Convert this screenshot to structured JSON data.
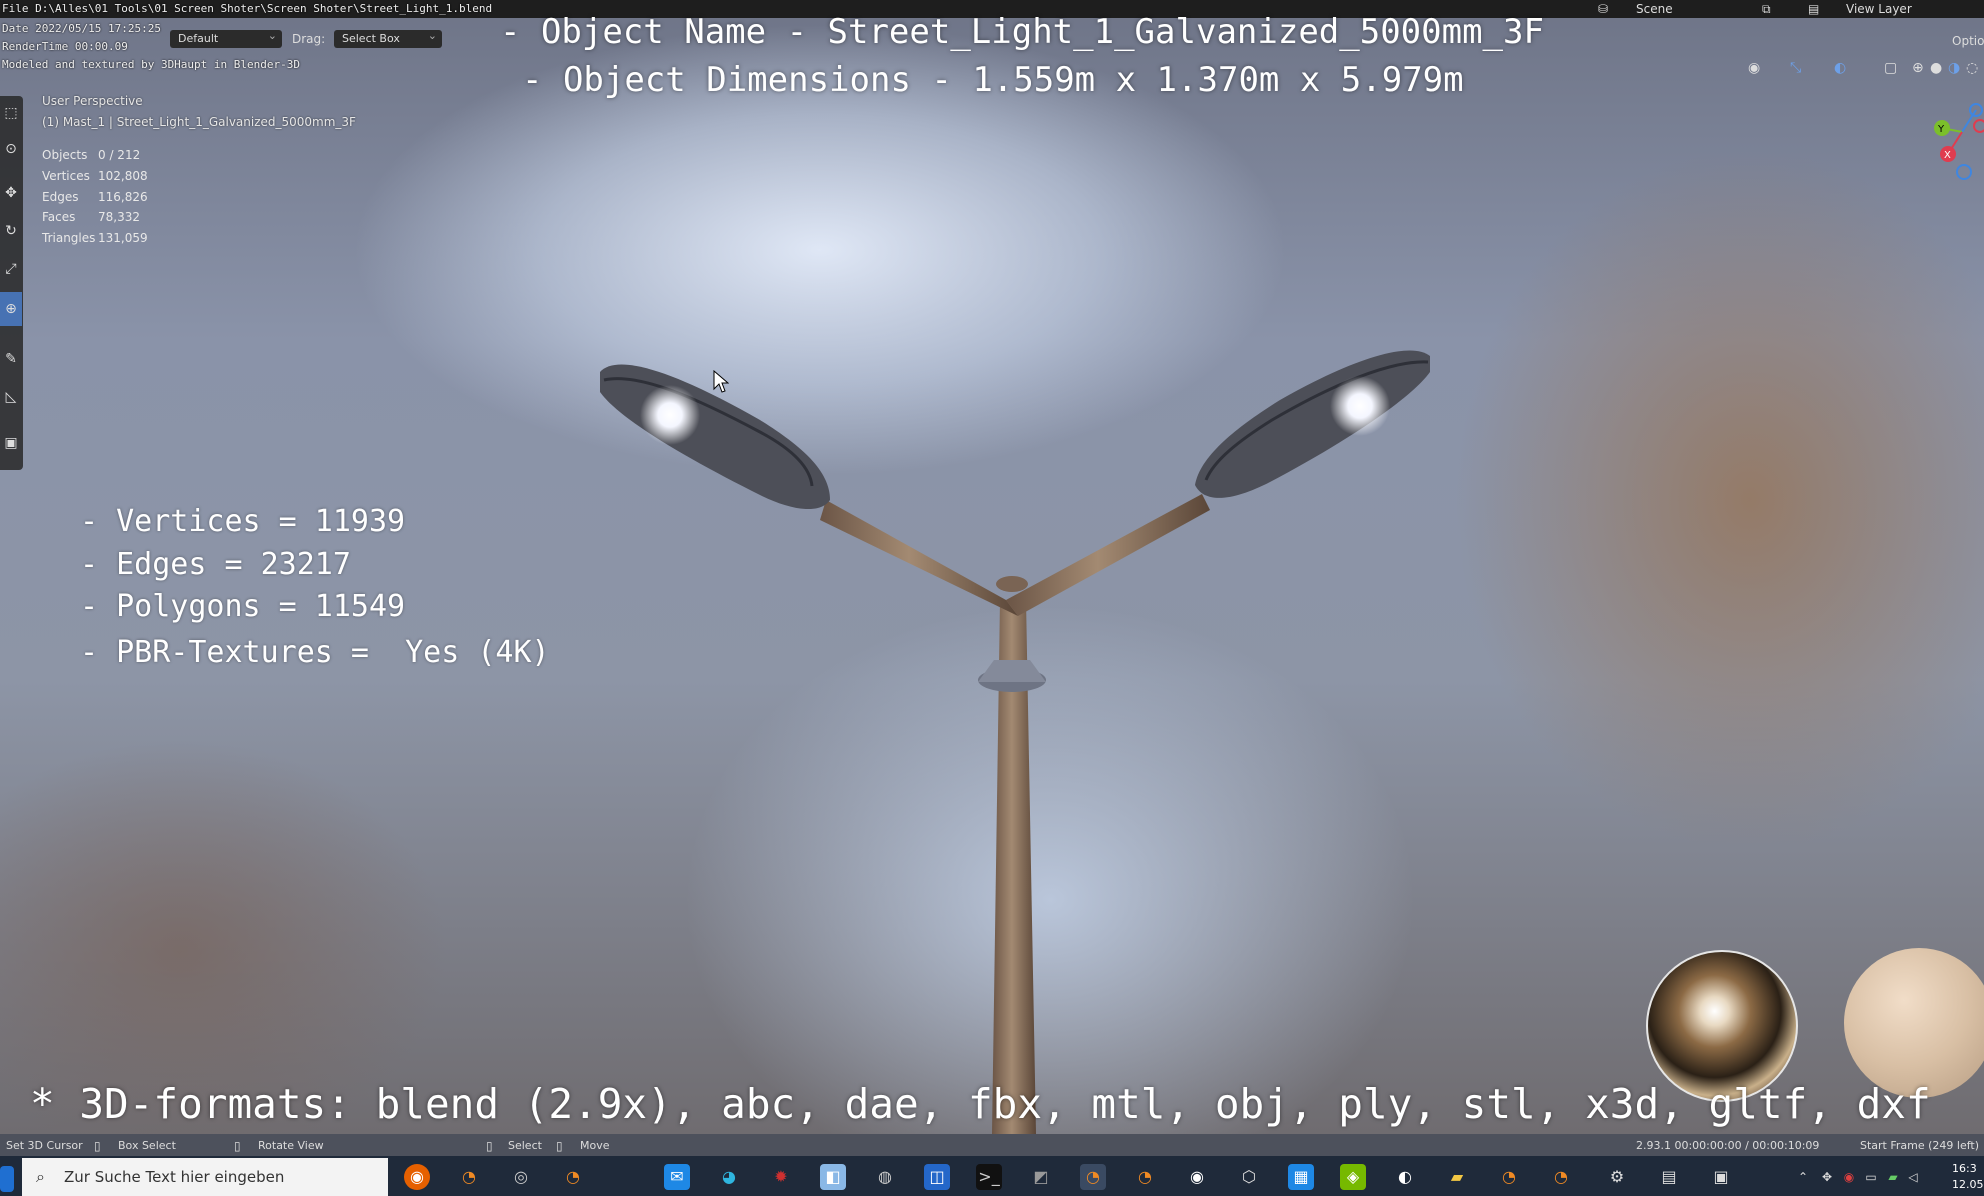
{
  "colors": {
    "accent": "#4772b3",
    "gizmo_x": "#e03c4f",
    "gizmo_y": "#7bbf2b",
    "gizmo_z": "#3f86e0"
  },
  "stamp": {
    "file": "File D:\\Alles\\01 Tools\\01 Screen Shoter\\Screen Shoter\\Street_Light_1.blend",
    "date": "Date 2022/05/15 17:25:25",
    "render_time": "RenderTime 00:00.09",
    "credit": "Modeled and textured by 3DHaupt in Blender-3D"
  },
  "header": {
    "orientation_label": "Default",
    "drag_label": "Drag:",
    "drag_value": "Select Box",
    "scene_label": "Scene",
    "view_layer_label": "View Layer",
    "options_label": "Optio"
  },
  "viewport_info": {
    "perspective": "User Perspective",
    "active_object": "(1) Mast_1 | Street_Light_1_Galvanized_5000mm_3F"
  },
  "stats": [
    {
      "label": "Objects",
      "value": "0 / 212"
    },
    {
      "label": "Vertices",
      "value": "102,808"
    },
    {
      "label": "Edges",
      "value": "116,826"
    },
    {
      "label": "Faces",
      "value": "78,332"
    },
    {
      "label": "Triangles",
      "value": "131,059"
    }
  ],
  "overlay": {
    "object_name": "- Object Name - Street_Light_1_Galvanized_5000mm_3F",
    "object_dimensions": "- Object Dimensions -  1.559m x 1.370m x 5.979m",
    "specs": [
      "- Vertices = 11939",
      "- Edges = 23217",
      "- Polygons = 11549",
      "- PBR-Textures =  Yes (4K)"
    ],
    "formats": "* 3D-formats: blend (2.9x), abc, dae, fbx, mtl, obj, ply, stl, x3d, gltf, dxf"
  },
  "gizmo": {
    "y": "Y",
    "x": "X"
  },
  "statusbar": {
    "set_cursor": "Set 3D Cursor",
    "box_select": "Box Select",
    "rotate_view": "Rotate View",
    "select": "Select",
    "move": "Move",
    "version_time": "2.93.1   00:00:00:00 / 00:00:10:09",
    "start_frame": "Start Frame (249 left)"
  },
  "taskbar": {
    "search_placeholder": "Zur Suche Text hier eingeben",
    "clock_time": "16:3",
    "clock_date": "12.05"
  }
}
